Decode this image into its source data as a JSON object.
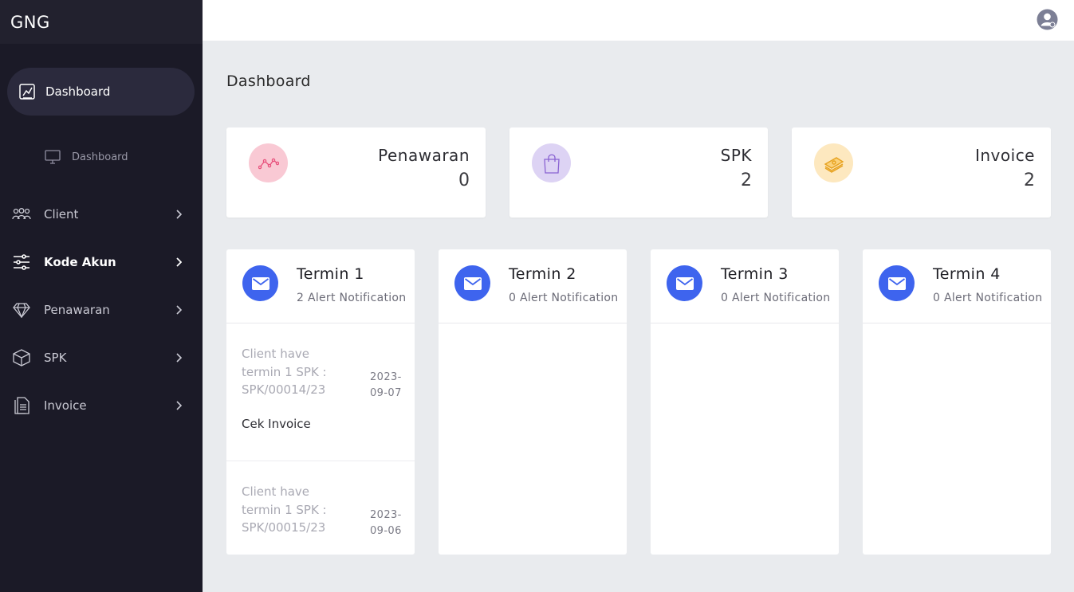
{
  "brand": "GNG",
  "sidebar": {
    "active": {
      "label": "Dashboard",
      "icon": "dashboard-chart-icon"
    },
    "sub_item": {
      "label": "Dashboard",
      "icon": "monitor-icon"
    },
    "items": [
      {
        "label": "Client",
        "icon": "users-icon"
      },
      {
        "label": "Kode Akun",
        "icon": "sliders-icon"
      },
      {
        "label": "Penawaran",
        "icon": "diamond-icon"
      },
      {
        "label": "SPK",
        "icon": "box-icon"
      },
      {
        "label": "Invoice",
        "icon": "document-icon"
      }
    ]
  },
  "topbar": {
    "user_icon": "user-avatar-icon"
  },
  "page_title": "Dashboard",
  "stats": [
    {
      "label": "Penawaran",
      "value": "0",
      "icon": "trend-line-icon",
      "color": "#f9c9d4"
    },
    {
      "label": "SPK",
      "value": "2",
      "icon": "shopping-bag-icon",
      "color": "#ddd3f4"
    },
    {
      "label": "Invoice",
      "value": "2",
      "icon": "money-stack-icon",
      "color": "#fde8bf"
    }
  ],
  "termins": [
    {
      "title": "Termin 1",
      "subtitle": "2 Alert Notification",
      "notifications": [
        {
          "text": "Client have termin 1 SPK : SPK/00014/23",
          "link": "Cek Invoice",
          "date": "2023-09-07"
        },
        {
          "text": "Client have termin 1 SPK : SPK/00015/23",
          "link": "",
          "date": "2023-09-06"
        }
      ]
    },
    {
      "title": "Termin 2",
      "subtitle": "0 Alert Notification",
      "notifications": []
    },
    {
      "title": "Termin 3",
      "subtitle": "0 Alert Notification",
      "notifications": []
    },
    {
      "title": "Termin 4",
      "subtitle": "0 Alert Notification",
      "notifications": []
    }
  ],
  "colors": {
    "sidebar_bg": "#1b1a27",
    "accent_blue": "#3e64ee",
    "page_bg": "#e9ebee"
  }
}
